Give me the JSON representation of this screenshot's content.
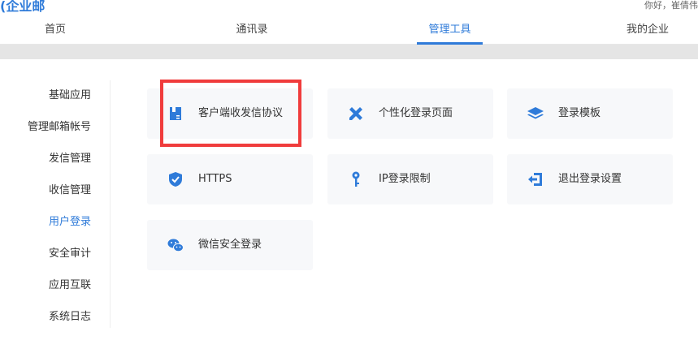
{
  "header": {
    "brand": "(企业邮",
    "greeting": "你好，崔倩伟"
  },
  "nav": {
    "tabs": [
      {
        "label": "首页"
      },
      {
        "label": "通讯录"
      },
      {
        "label": "管理工具",
        "active": true
      },
      {
        "label": "我的企业"
      }
    ]
  },
  "sidebar": {
    "items": [
      {
        "label": "基础应用"
      },
      {
        "label": "管理邮箱帐号"
      },
      {
        "label": "发信管理"
      },
      {
        "label": "收信管理"
      },
      {
        "label": "用户登录",
        "active": true
      },
      {
        "label": "安全审计"
      },
      {
        "label": "应用互联"
      },
      {
        "label": "系统日志"
      }
    ]
  },
  "cards": [
    {
      "label": "客户端收发信协议",
      "icon": "client-protocol-icon",
      "highlighted": true
    },
    {
      "label": "个性化登录页面",
      "icon": "pencil-ruler-icon"
    },
    {
      "label": "登录模板",
      "icon": "layers-icon"
    },
    {
      "label": "HTTPS",
      "icon": "shield-check-icon"
    },
    {
      "label": "IP登录限制",
      "icon": "key-icon"
    },
    {
      "label": "退出登录设置",
      "icon": "logout-icon"
    },
    {
      "label": "微信安全登录",
      "icon": "wechat-icon"
    }
  ],
  "colors": {
    "accent": "#2f7bd9",
    "highlight_border": "#f03c3c",
    "card_bg": "#f7f8fa"
  }
}
